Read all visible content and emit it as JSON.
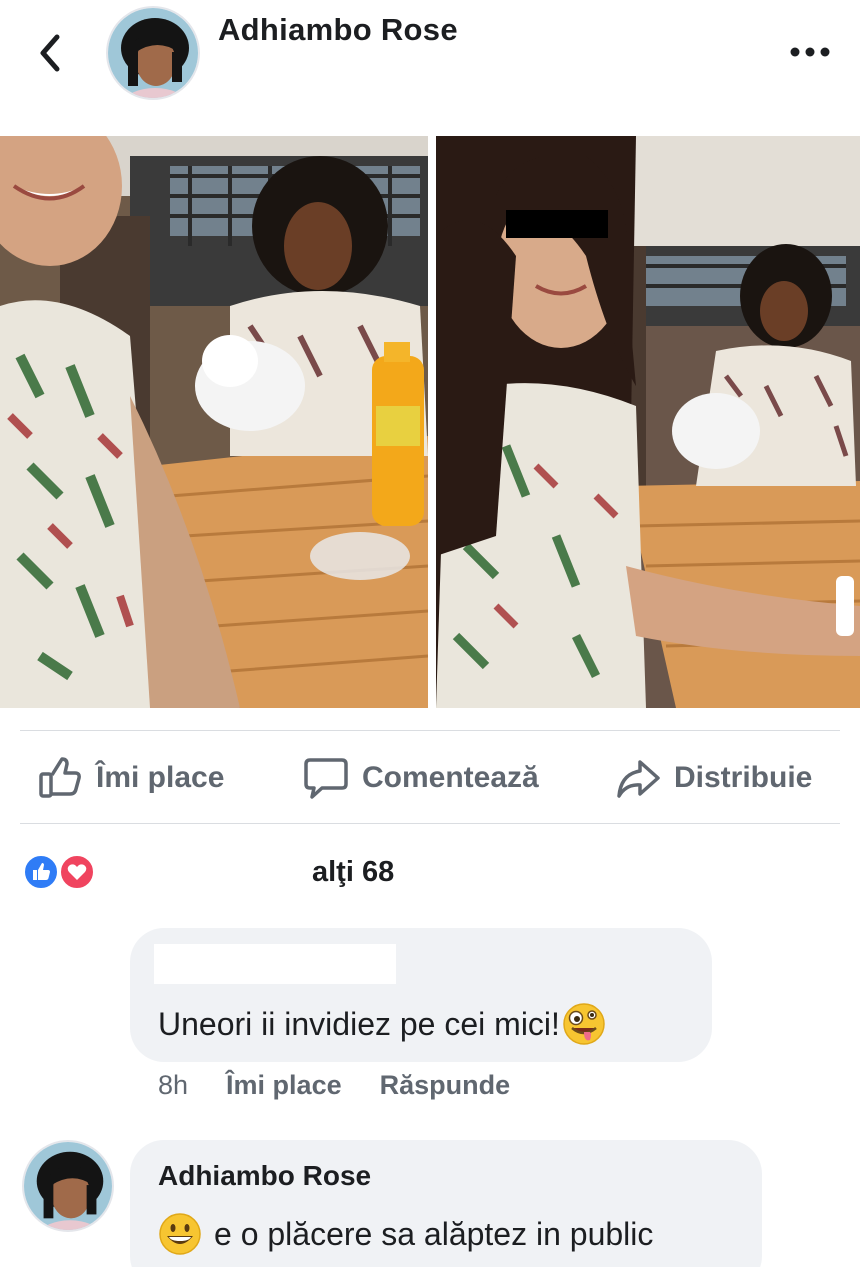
{
  "header": {
    "name": "Adhiambo Rose"
  },
  "actions": {
    "like_label": "Îmi place",
    "comment_label": "Comentează",
    "share_label": "Distribuie"
  },
  "reactions": {
    "count_text": "alţi 68"
  },
  "comments": [
    {
      "author": "",
      "text": "Uneori ii invidiez pe cei mici!",
      "emoji": "zany-face-emoji",
      "time": "8h",
      "like_label": "Îmi place",
      "reply_label": "Răspunde"
    },
    {
      "author": "Adhiambo Rose",
      "emoji": "grinning-face-emoji",
      "text": "e o plăcere sa alăptez in public"
    }
  ],
  "colors": {
    "accent": "#2f7cf6",
    "love": "#f0445f",
    "muted_text": "#606770",
    "bubble": "#f0f2f5"
  }
}
